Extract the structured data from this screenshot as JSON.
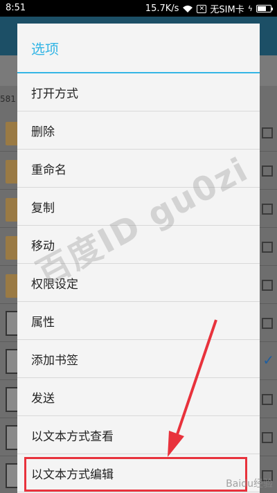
{
  "status_bar": {
    "time": "8:51",
    "speed": "15.7K/s",
    "sim": "无SIM卡",
    "sim_box_glyph": "✕",
    "bolt_glyph": "ϟ"
  },
  "background": {
    "size_fragment": "581"
  },
  "dialog": {
    "title": "选项",
    "items": [
      {
        "label": "打开方式"
      },
      {
        "label": "删除"
      },
      {
        "label": "重命名"
      },
      {
        "label": "复制"
      },
      {
        "label": "移动"
      },
      {
        "label": "权限设定"
      },
      {
        "label": "属性"
      },
      {
        "label": "添加书签"
      },
      {
        "label": "发送"
      },
      {
        "label": "以文本方式查看"
      },
      {
        "label": "以文本方式编辑"
      }
    ]
  },
  "overlay": {
    "watermark": "百度ID gu0zi",
    "corner_mark": "Baidu经验",
    "highlight_color": "#e8323c"
  },
  "colors": {
    "accent": "#33b5e5",
    "dialog_bg": "#f4f4f4"
  }
}
